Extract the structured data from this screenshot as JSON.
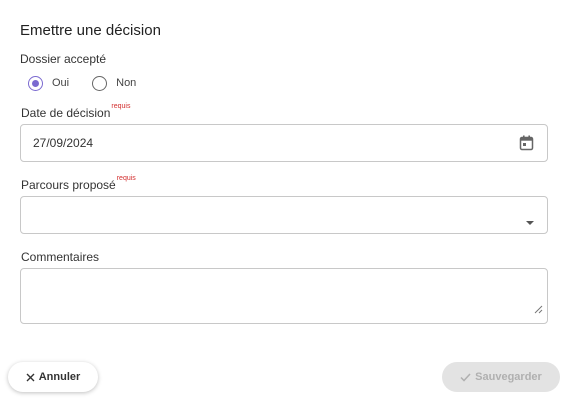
{
  "title": "Emettre une décision",
  "dossier": {
    "label": "Dossier accepté",
    "options": [
      {
        "label": "Oui",
        "checked": true
      },
      {
        "label": "Non",
        "checked": false
      }
    ]
  },
  "date": {
    "label": "Date de décision",
    "required_tag": "requis",
    "value": "27/09/2024",
    "icon": "calendar-icon"
  },
  "parcours": {
    "label": "Parcours proposé",
    "required_tag": "requis",
    "value": "",
    "icon": "chevron-down-icon"
  },
  "commentaires": {
    "label": "Commentaires",
    "value": ""
  },
  "actions": {
    "cancel_label": "Annuler",
    "save_label": "Sauvegarder"
  },
  "colors": {
    "accent": "#7b6ad0",
    "required": "#d32f2f",
    "disabled_bg": "#e3e3e3"
  }
}
